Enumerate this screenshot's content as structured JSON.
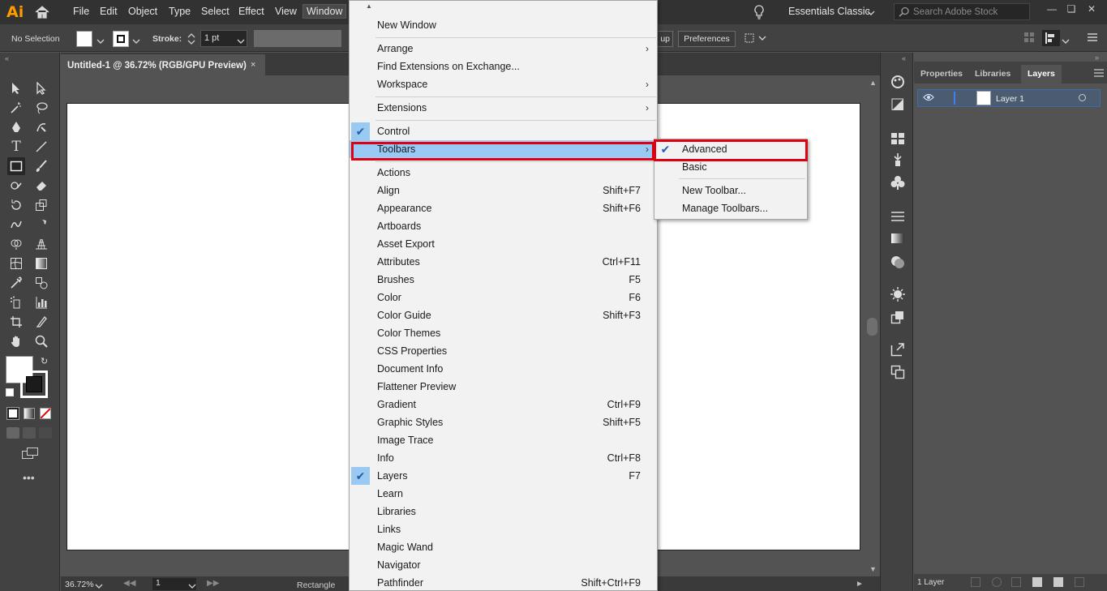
{
  "app": {
    "logo": "Ai",
    "accent": "#ff9a00"
  },
  "menubar": {
    "items": [
      "File",
      "Edit",
      "Object",
      "Type",
      "Select",
      "Effect",
      "View",
      "Window"
    ],
    "active": "Window",
    "workspace": "Essentials Classic",
    "search_placeholder": "Search Adobe Stock"
  },
  "control": {
    "selection": "No Selection",
    "stroke_label": "Stroke:",
    "stroke_value": "1 pt",
    "up_label": "up",
    "preferences": "Preferences"
  },
  "document": {
    "tab_title": "Untitled-1 @ 36.72% (RGB/GPU Preview)",
    "close": "×",
    "zoom": "36.72%",
    "page": "1",
    "tool_name": "Rectangle"
  },
  "right_panel": {
    "tabs": [
      "Properties",
      "Libraries",
      "Layers"
    ],
    "active_tab": "Layers",
    "layer_name": "Layer 1",
    "layer_count": "1 Layer"
  },
  "window_menu": {
    "items": [
      {
        "label": "New Window"
      },
      {
        "label": "Arrange",
        "submenu": true
      },
      {
        "label": "Find Extensions on Exchange..."
      },
      {
        "label": "Workspace",
        "submenu": true
      },
      {
        "label": "Extensions",
        "submenu": true
      },
      {
        "label": "Control",
        "checked": true
      },
      {
        "label": "Toolbars",
        "submenu": true,
        "highlighted": true
      },
      {
        "label": "Actions"
      },
      {
        "label": "Align",
        "shortcut": "Shift+F7"
      },
      {
        "label": "Appearance",
        "shortcut": "Shift+F6"
      },
      {
        "label": "Artboards"
      },
      {
        "label": "Asset Export"
      },
      {
        "label": "Attributes",
        "shortcut": "Ctrl+F11"
      },
      {
        "label": "Brushes",
        "shortcut": "F5"
      },
      {
        "label": "Color",
        "shortcut": "F6"
      },
      {
        "label": "Color Guide",
        "shortcut": "Shift+F3"
      },
      {
        "label": "Color Themes"
      },
      {
        "label": "CSS Properties"
      },
      {
        "label": "Document Info"
      },
      {
        "label": "Flattener Preview"
      },
      {
        "label": "Gradient",
        "shortcut": "Ctrl+F9"
      },
      {
        "label": "Graphic Styles",
        "shortcut": "Shift+F5"
      },
      {
        "label": "Image Trace"
      },
      {
        "label": "Info",
        "shortcut": "Ctrl+F8"
      },
      {
        "label": "Layers",
        "shortcut": "F7",
        "checked": true
      },
      {
        "label": "Learn"
      },
      {
        "label": "Libraries"
      },
      {
        "label": "Links"
      },
      {
        "label": "Magic Wand"
      },
      {
        "label": "Navigator"
      },
      {
        "label": "Pathfinder",
        "shortcut": "Shift+Ctrl+F9"
      }
    ]
  },
  "toolbars_submenu": {
    "items": [
      {
        "label": "Advanced",
        "checked": true
      },
      {
        "label": "Basic"
      },
      {
        "label": "New Toolbar..."
      },
      {
        "label": "Manage Toolbars..."
      }
    ]
  },
  "highlight_color": "#e1000f"
}
